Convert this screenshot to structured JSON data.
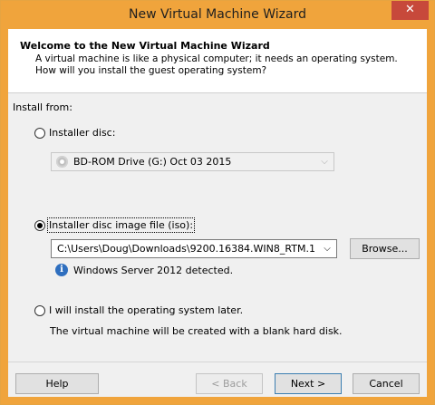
{
  "window": {
    "title": "New Virtual Machine Wizard",
    "close_label": "✕"
  },
  "header": {
    "title": "Welcome to the New Virtual Machine Wizard",
    "description": "A virtual machine is like a physical computer; it needs an operating system. How will you install the guest operating system?"
  },
  "install_from": {
    "label": "Install from:",
    "options": [
      {
        "label": "Installer disc:",
        "selected": false
      },
      {
        "label": "Installer disc image file (iso):",
        "selected": true
      },
      {
        "label": "I will install the operating system later.",
        "selected": false
      }
    ],
    "disc_drive": {
      "value": "BD-ROM Drive (G:) Oct 03 2015"
    },
    "iso_path": {
      "value": "C:\\Users\\Doug\\Downloads\\9200.16384.WIN8_RTM.1"
    },
    "browse_label": "Browse...",
    "detected_text": "Windows Server 2012 detected.",
    "later_note": "The virtual machine will be created with a blank hard disk."
  },
  "footer": {
    "help_label": "Help",
    "back_label": "< Back",
    "next_label": "Next >",
    "cancel_label": "Cancel"
  },
  "colors": {
    "title_bar": "#f0a43c",
    "close_button": "#c7493b",
    "info_icon": "#2f6fbf"
  }
}
